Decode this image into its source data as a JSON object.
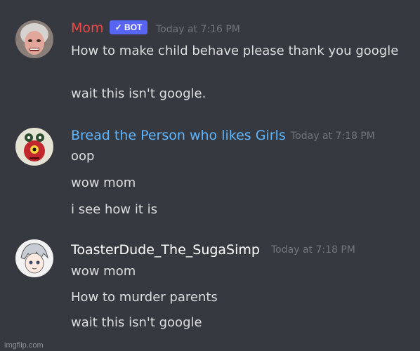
{
  "messages": [
    {
      "author": "Mom",
      "author_color": "#f04747",
      "badge": "BOT",
      "timestamp": "Today at 7:16 PM",
      "lines": [
        "How to make child behave please thank you google",
        "wait this isn't google."
      ],
      "avatar_icon": "elderly-woman-avatar"
    },
    {
      "author": "Bread the Person who likes Girls",
      "author_color": "#5fb6ff",
      "timestamp": "Today at 7:18 PM",
      "lines": [
        "oop",
        "wow mom",
        "i see how it is"
      ],
      "avatar_icon": "red-cartoon-creature-avatar"
    },
    {
      "author": "ToasterDude_The_SugaSimp",
      "author_color": "#ffffff",
      "timestamp": "Today at 7:18 PM",
      "lines": [
        "wow mom",
        "How to murder parents",
        "wait this isn't google"
      ],
      "avatar_icon": "anime-boy-avatar"
    }
  ],
  "watermark": "imgflip.com"
}
